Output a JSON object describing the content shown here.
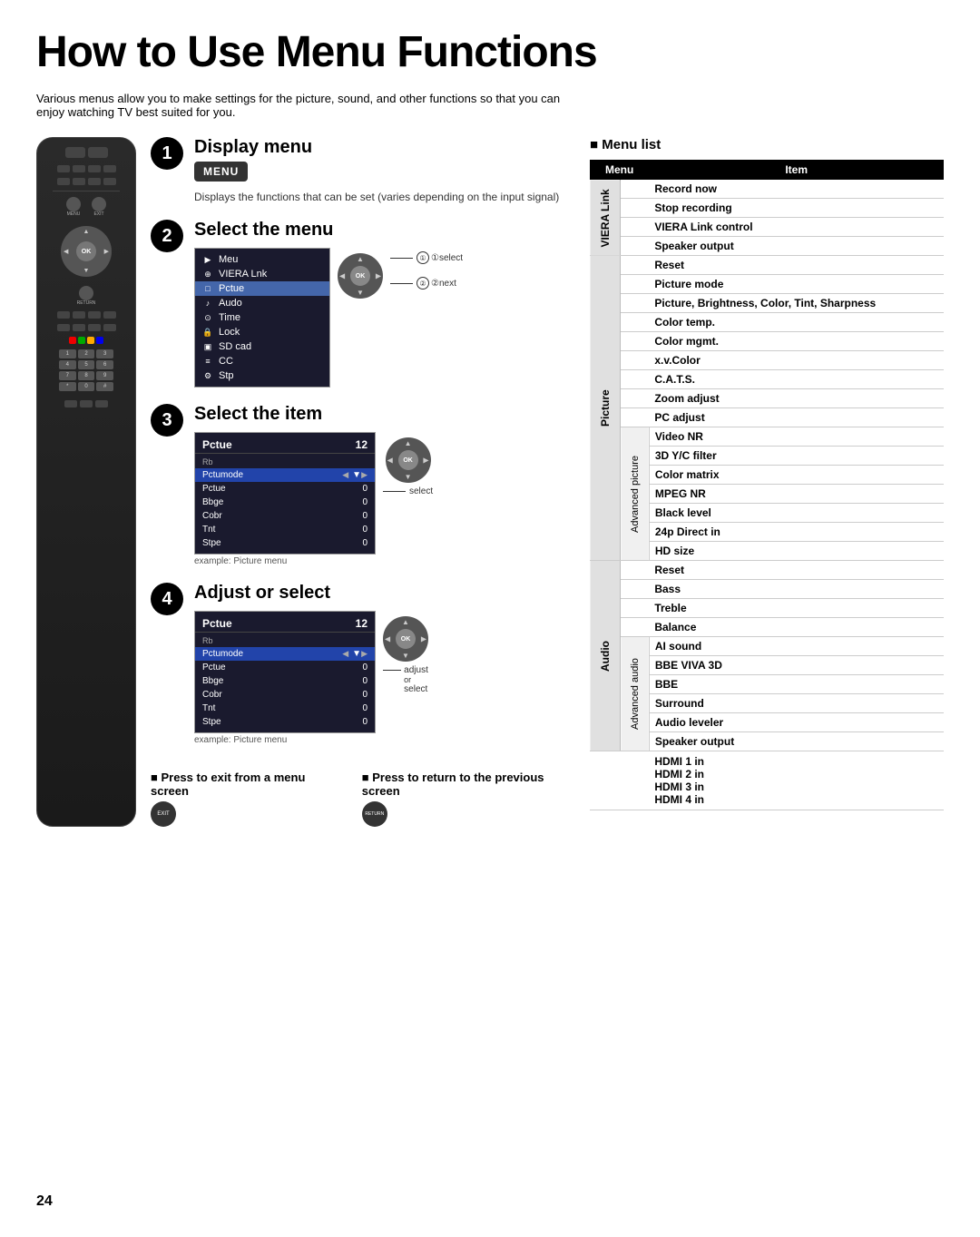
{
  "page": {
    "title": "How to Use Menu Functions",
    "intro": "Various menus allow you to make settings for the picture, sound, and other functions so that you can enjoy watching TV best suited for you.",
    "page_number": "24"
  },
  "steps": [
    {
      "number": "1",
      "title": "Display menu",
      "menu_label": "MENU",
      "bullet": "Displays the functions that can be set (varies depending on the input signal)"
    },
    {
      "number": "2",
      "title": "Select the menu",
      "annotation1": "①select",
      "annotation2": "②next"
    },
    {
      "number": "3",
      "title": "Select the item",
      "annotation": "select",
      "example": "example: Picture menu"
    },
    {
      "number": "4",
      "title": "Adjust or select",
      "annotation": "adjust or select",
      "example": "example: Picture menu"
    }
  ],
  "press_exit": {
    "title": "Press to exit from a menu screen",
    "label": "EXIT"
  },
  "press_return": {
    "title": "Press to return to the previous screen",
    "label": "RETURN"
  },
  "menu_list": {
    "title": "Menu list",
    "headers": [
      "Menu",
      "Item"
    ],
    "sections": [
      {
        "section_name": "VIERA Link",
        "items": [
          {
            "name": "Record now",
            "indent": false
          },
          {
            "name": "Stop recording",
            "indent": false
          },
          {
            "name": "VIERA Link control",
            "indent": false
          },
          {
            "name": "Speaker output",
            "indent": false
          }
        ]
      },
      {
        "section_name": "Picture",
        "items": [
          {
            "name": "Reset",
            "indent": false
          },
          {
            "name": "Picture mode",
            "indent": false
          },
          {
            "name": "Picture, Brightness, Color, Tint, Sharpness",
            "indent": false
          },
          {
            "name": "Color temp.",
            "indent": false
          },
          {
            "name": "Color mgmt.",
            "indent": false
          },
          {
            "name": "x.v.Color",
            "indent": false
          },
          {
            "name": "C.A.T.S.",
            "indent": false
          },
          {
            "name": "Zoom adjust",
            "indent": false
          },
          {
            "name": "PC adjust",
            "indent": false
          }
        ],
        "subsections": [
          {
            "sub_name": "Advanced picture",
            "items": [
              {
                "name": "Video NR",
                "indent": true
              },
              {
                "name": "3D Y/C filter",
                "indent": true
              },
              {
                "name": "Color matrix",
                "indent": true
              },
              {
                "name": "MPEG NR",
                "indent": true
              },
              {
                "name": "Black level",
                "indent": true
              },
              {
                "name": "24p Direct in",
                "indent": true
              },
              {
                "name": "HD size",
                "indent": true
              }
            ]
          }
        ]
      },
      {
        "section_name": "Audio",
        "items": [
          {
            "name": "Reset",
            "indent": false
          },
          {
            "name": "Bass",
            "indent": false
          },
          {
            "name": "Treble",
            "indent": false
          },
          {
            "name": "Balance",
            "indent": false
          }
        ],
        "subsections": [
          {
            "sub_name": "Advanced audio",
            "items": [
              {
                "name": "AI sound",
                "indent": true
              },
              {
                "name": "BBE VIVA 3D",
                "indent": true
              },
              {
                "name": "BBE",
                "indent": true
              },
              {
                "name": "Surround",
                "indent": true
              },
              {
                "name": "Audio leveler",
                "indent": true
              },
              {
                "name": "Speaker output",
                "indent": true
              }
            ]
          }
        ]
      }
    ],
    "hdmi_items": [
      "HDMI 1 in",
      "HDMI 2 in",
      "HDMI 3 in",
      "HDMI 4 in"
    ]
  },
  "menu_screen_items": [
    {
      "icon": "▶",
      "label": "Meu",
      "highlighted": false
    },
    {
      "icon": "⊕",
      "label": "VIERA Lnk",
      "highlighted": false
    },
    {
      "icon": "□",
      "label": "Pctue",
      "highlighted": true
    },
    {
      "icon": "♪",
      "label": "Audo",
      "highlighted": false
    },
    {
      "icon": "⊙",
      "label": "Time",
      "highlighted": false
    },
    {
      "icon": "🔒",
      "label": "Lock",
      "highlighted": false
    },
    {
      "icon": "▣",
      "label": "SD cad",
      "highlighted": false
    },
    {
      "icon": "≡",
      "label": "CC",
      "highlighted": false
    },
    {
      "icon": "⚙",
      "label": "Stp",
      "highlighted": false
    }
  ],
  "item_screen": {
    "title": "Pctue",
    "number": "12",
    "sub_label": "Rb",
    "rows": [
      {
        "label": "Pctumode",
        "value": "▼",
        "hasArrows": true
      },
      {
        "label": "Pctue",
        "value": "0"
      },
      {
        "label": "Bbge",
        "value": "0"
      },
      {
        "label": "Cobr",
        "value": "0"
      },
      {
        "label": "Tnt",
        "value": "0"
      },
      {
        "label": "Stpe",
        "value": "0"
      }
    ]
  }
}
